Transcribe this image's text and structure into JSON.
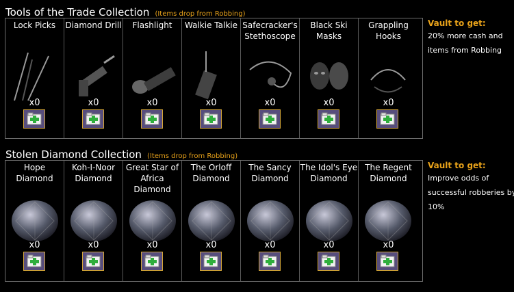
{
  "collections": [
    {
      "title": "Tools of the Trade Collection",
      "subtitle": "(Items drop from Robbing)",
      "items": [
        {
          "name": "Lock Picks",
          "qty": "x0",
          "icon": "lock-picks-icon"
        },
        {
          "name": "Diamond Drill",
          "qty": "x0",
          "icon": "diamond-drill-icon"
        },
        {
          "name": "Flashlight",
          "qty": "x0",
          "icon": "flashlight-icon"
        },
        {
          "name": "Walkie Talkie",
          "qty": "x0",
          "icon": "walkie-talkie-icon"
        },
        {
          "name": "Safecracker's Stethoscope",
          "qty": "x0",
          "icon": "stethoscope-icon"
        },
        {
          "name": "Black Ski Masks",
          "qty": "x0",
          "icon": "ski-mask-icon"
        },
        {
          "name": "Grappling Hooks",
          "qty": "x0",
          "icon": "grappling-hook-icon"
        }
      ],
      "vault_title": "Vault to get:",
      "vault_desc": "20% more cash and items from Robbing"
    },
    {
      "title": "Stolen Diamond Collection",
      "subtitle": "(Items drop from Robbing)",
      "items": [
        {
          "name": "Hope Diamond",
          "qty": "x0",
          "icon": "hope-diamond-icon"
        },
        {
          "name": "Koh-I-Noor Diamond",
          "qty": "x0",
          "icon": "koh-i-noor-diamond-icon"
        },
        {
          "name": "Great Star of Africa Diamond",
          "qty": "x0",
          "icon": "great-star-diamond-icon"
        },
        {
          "name": "The Orloff Diamond",
          "qty": "x0",
          "icon": "orloff-diamond-icon"
        },
        {
          "name": "The Sancy Diamond",
          "qty": "x0",
          "icon": "sancy-diamond-icon"
        },
        {
          "name": "The Idol's Eye Diamond",
          "qty": "x0",
          "icon": "idols-eye-diamond-icon"
        },
        {
          "name": "The Regent Diamond",
          "qty": "x0",
          "icon": "regent-diamond-icon"
        }
      ],
      "vault_title": "Vault to get:",
      "vault_desc": "Improve odds of successful robberies by 10%"
    }
  ],
  "gift_icon": "gift-icon",
  "colors": {
    "accent": "#e8a21a",
    "gift_bg": "#574d7d",
    "gift_border": "#d7a838",
    "gift_plus": "#2fae3c"
  }
}
